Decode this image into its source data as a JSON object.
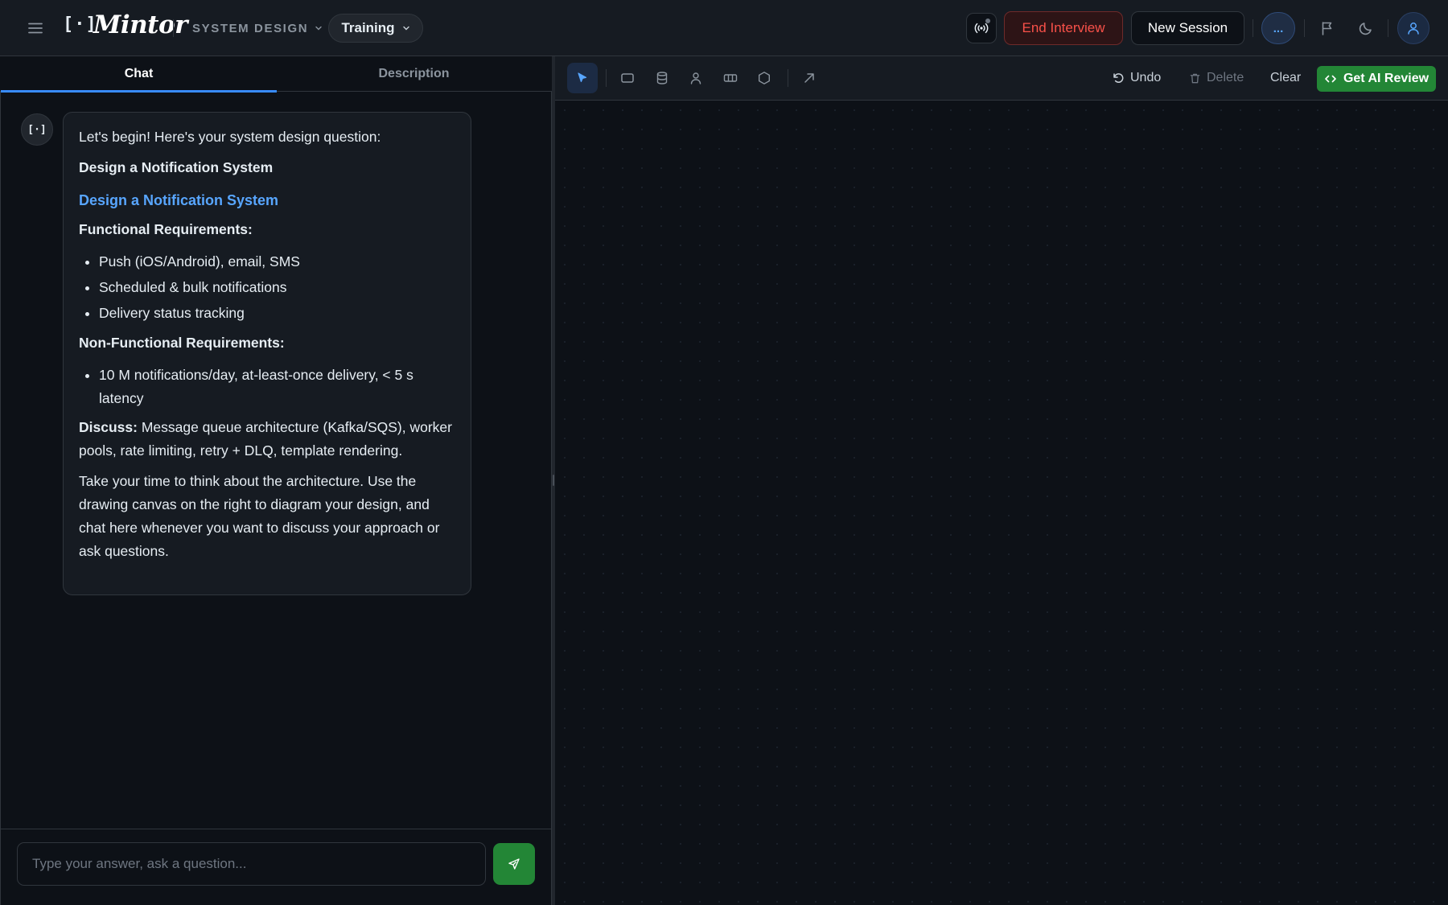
{
  "header": {
    "brand_brackets": "[·]",
    "brand_name": "Mintor",
    "context_label": "SYSTEM DESIGN",
    "mode_label": "Training",
    "end_label": "End Interview",
    "new_label": "New Session",
    "more_label": "...",
    "icons": [
      "hamburger-icon",
      "chevron-down-icon",
      "broadcast-icon",
      "flag-icon",
      "moon-icon",
      "user-icon"
    ]
  },
  "tabs": {
    "chat": "Chat",
    "description": "Description"
  },
  "chat": {
    "avatar": "[·]",
    "message": {
      "intro": "Let's begin! Here's your system design question:",
      "title": "Design a Notification System",
      "heading": "Design a Notification System",
      "functional_heading": "Functional Requirements:",
      "functional_items": [
        "Push (iOS/Android), email, SMS",
        "Scheduled & bulk notifications",
        "Delivery status tracking"
      ],
      "nonfunctional_heading": "Non-Functional Requirements:",
      "nonfunctional_items": [
        "10 M notifications/day, at-least-once delivery, < 5 s latency"
      ],
      "discuss_label": "Discuss:",
      "discuss_text": " Message queue architecture (Kafka/SQS), worker pools, rate limiting, retry + DLQ, template rendering.",
      "closing": "Take your time to think about the architecture. Use the drawing canvas on the right to diagram your design, and chat here whenever you want to discuss your approach or ask questions."
    },
    "input": {
      "placeholder": "Type your answer, ask a question...",
      "value": ""
    }
  },
  "toolbar": {
    "tools": [
      "select-tool",
      "rectangle-tool",
      "database-tool",
      "user-tool",
      "queue-tool",
      "hexagon-tool",
      "arrow-tool"
    ],
    "undo_label": "Undo",
    "delete_label": "Delete",
    "clear_label": "Clear",
    "review_label": "Get AI Review"
  },
  "colors": {
    "accent_blue": "#58a6ff",
    "danger_red": "#f85149",
    "success_green": "#238636",
    "background": "#0d1117"
  }
}
